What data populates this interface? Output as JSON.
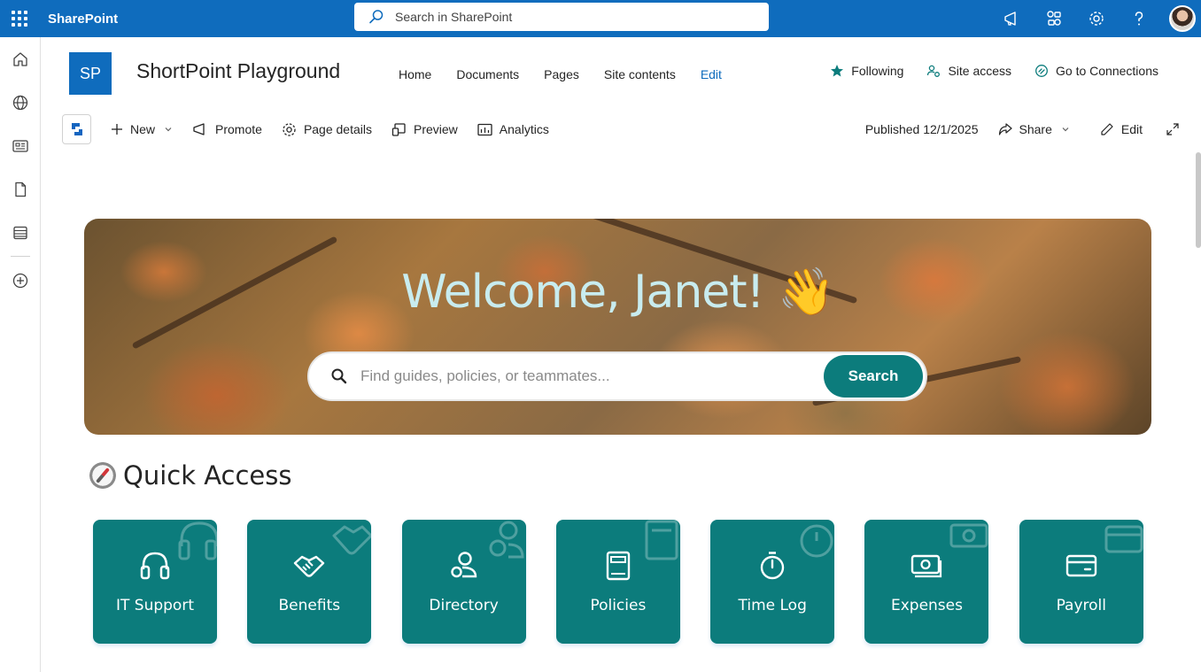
{
  "suite": {
    "app_name": "SharePoint",
    "search_placeholder": "Search in SharePoint"
  },
  "site": {
    "logo_text": "SP",
    "title": "ShortPoint Playground",
    "nav": [
      "Home",
      "Documents",
      "Pages",
      "Site contents",
      "Edit"
    ],
    "actions": {
      "following": "Following",
      "site_access": "Site access",
      "connections": "Go to Connections"
    }
  },
  "commandbar": {
    "new": "New",
    "promote": "Promote",
    "page_details": "Page details",
    "preview": "Preview",
    "analytics": "Analytics",
    "published": "Published 12/1/2025",
    "share": "Share",
    "edit": "Edit"
  },
  "hero": {
    "title": "Welcome, Janet! 👋",
    "search_placeholder": "Find guides, policies, or teammates...",
    "search_button": "Search"
  },
  "quick_access": {
    "heading": "Quick Access",
    "tiles": [
      {
        "label": "IT Support",
        "icon": "headset-icon"
      },
      {
        "label": "Benefits",
        "icon": "handshake-icon"
      },
      {
        "label": "Directory",
        "icon": "people-icon"
      },
      {
        "label": "Policies",
        "icon": "book-icon"
      },
      {
        "label": "Time Log",
        "icon": "stopwatch-icon"
      },
      {
        "label": "Expenses",
        "icon": "money-icon"
      },
      {
        "label": "Payroll",
        "icon": "credit-card-icon"
      }
    ]
  },
  "colors": {
    "brand": "#0f6cbd",
    "tile": "#0c7c7c",
    "hero_title": "#c8ecef"
  }
}
